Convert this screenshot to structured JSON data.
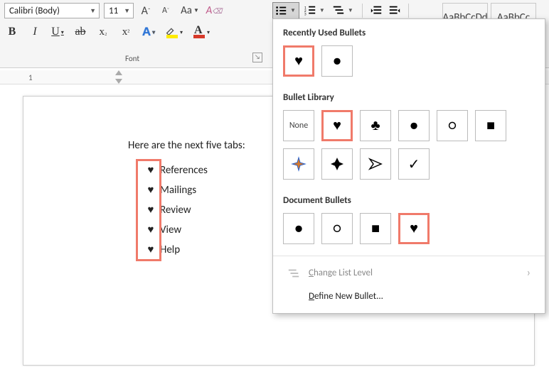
{
  "ribbon": {
    "font_name": "Calibri (Body)",
    "font_size": "11",
    "grow": "A",
    "shrink": "A",
    "change_case": "Aa",
    "clear_fmt": "A",
    "bold": "B",
    "italic": "I",
    "underline": "U",
    "strike": "ab",
    "subscript": "x",
    "superscript": "x",
    "text_effects": "A",
    "highlight": "",
    "font_color": "A",
    "group_label": "Font",
    "style1": "AaBbCcDd",
    "style2": "AaBbCc"
  },
  "ruler_num": "1",
  "document": {
    "intro": "Here are the next five tabs:",
    "items": [
      {
        "bullet": "♥",
        "text": "References"
      },
      {
        "bullet": "♥",
        "text": "Mailings"
      },
      {
        "bullet": "♥",
        "text": "Review"
      },
      {
        "bullet": "♥",
        "text": "View"
      },
      {
        "bullet": "♥",
        "text": "Help"
      }
    ]
  },
  "bullet_panel": {
    "recent_title": "Recently Used Bullets",
    "recent": [
      "♥",
      "●"
    ],
    "library_title": "Bullet Library",
    "library": [
      "None",
      "♥",
      "♣",
      "●",
      "○",
      "■",
      "✦",
      "❖",
      "➤",
      "✓"
    ],
    "doc_title": "Document Bullets",
    "doc": [
      "●",
      "○",
      "■",
      "♥"
    ],
    "change_level": "Change List Level",
    "define_new": "Define New Bullet..."
  }
}
